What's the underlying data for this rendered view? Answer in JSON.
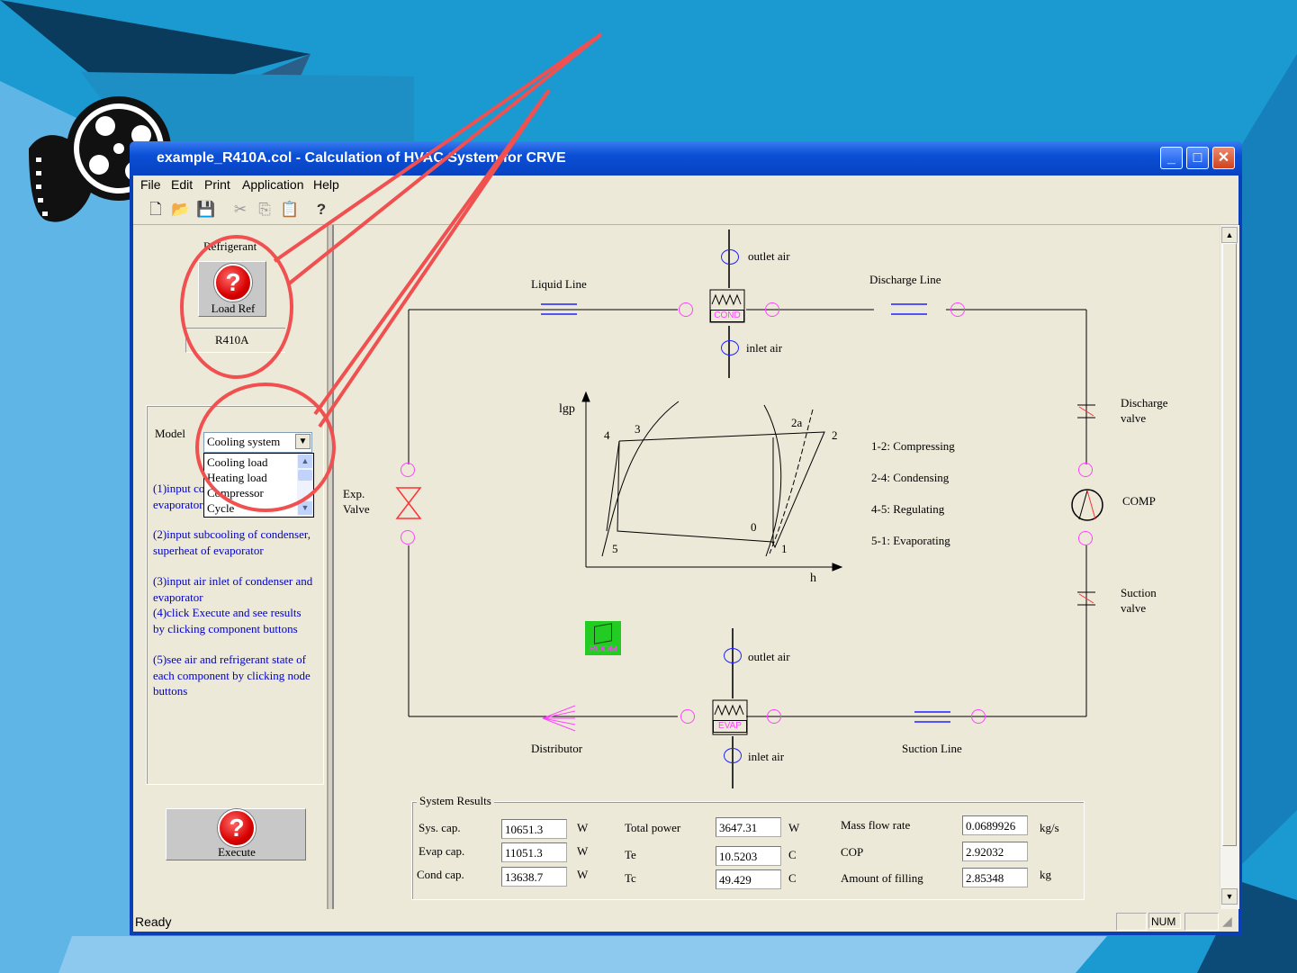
{
  "window": {
    "title": "example_R410A.col - Calculation of HVAC System for CRVE",
    "minimize": "_",
    "maximize": "□",
    "close": "✕"
  },
  "menu": [
    "File",
    "Edit",
    "Print",
    "Application",
    "Help"
  ],
  "toolbar": [
    "new-icon",
    "open-icon",
    "save-icon",
    "cut-icon",
    "copy-icon",
    "paste-icon",
    "help-icon"
  ],
  "left_panel": {
    "refrigerant_label": "Refrigerant",
    "load_ref_button": "Load Ref",
    "refrigerant_value": "R410A",
    "model_label": "Model",
    "model_selected": "Cooling system",
    "model_options": [
      "Cooling load",
      "Heating load",
      "Compressor",
      "Cycle"
    ],
    "instructions": [
      "(1)input compressor, condenser, evaporator",
      "(2)input subcooling of condenser, superheat of evaporator",
      "(3)input air inlet of condenser and evaporator",
      "(4)click Execute and see results by clicking component buttons",
      "(5)see air and refrigerant state of each component by clicking node buttons"
    ],
    "execute_button": "Execute"
  },
  "diagram": {
    "outlet_air_top": "outlet air",
    "inlet_air_top": "inlet air",
    "liquid_line": "Liquid Line",
    "discharge_line": "Discharge Line",
    "cond": "COND",
    "evap": "EVAP",
    "room": "ROOM",
    "discharge_valve": [
      "Discharge",
      "valve"
    ],
    "comp": "COMP",
    "suction_valve": [
      "Suction",
      "valve"
    ],
    "exp_valve": [
      "Exp.",
      "Valve"
    ],
    "outlet_air_bottom": "outlet air",
    "inlet_air_bottom": "inlet air",
    "distributor": "Distributor",
    "suction_line": "Suction Line",
    "ph_chart": {
      "y_axis": "lgp",
      "x_axis": "h",
      "points": [
        "1",
        "2",
        "2a",
        "3",
        "4",
        "5",
        "0"
      ]
    },
    "legend": [
      "1-2: Compressing",
      "2-4: Condensing",
      "4-5: Regulating",
      "5-1: Evaporating"
    ]
  },
  "results": {
    "title": "System Results",
    "rows": [
      {
        "label": "Sys. cap.",
        "value": "10651.3",
        "unit": "W"
      },
      {
        "label": "Evap cap.",
        "value": "11051.3",
        "unit": "W"
      },
      {
        "label": "Cond cap.",
        "value": "13638.7",
        "unit": "W"
      },
      {
        "label": "Total power",
        "value": "3647.31",
        "unit": "W"
      },
      {
        "label": "Te",
        "value": "10.5203",
        "unit": "C"
      },
      {
        "label": "Tc",
        "value": "49.429",
        "unit": "C"
      },
      {
        "label": "Mass flow rate",
        "value": "0.0689926",
        "unit": "kg/s"
      },
      {
        "label": "COP",
        "value": "2.92032",
        "unit": ""
      },
      {
        "label": "Amount of filling",
        "value": "2.85348",
        "unit": "kg"
      }
    ]
  },
  "status": {
    "text": "Ready",
    "num": "NUM"
  },
  "colors": {
    "background": "#1a9ad0",
    "title_bar": "#0a4fd6",
    "callout": "#f05050",
    "node_magenta": "#ff44ff",
    "node_blue": "#2222ff",
    "room_green": "#22cc22",
    "instructions_blue": "#0000cc"
  }
}
